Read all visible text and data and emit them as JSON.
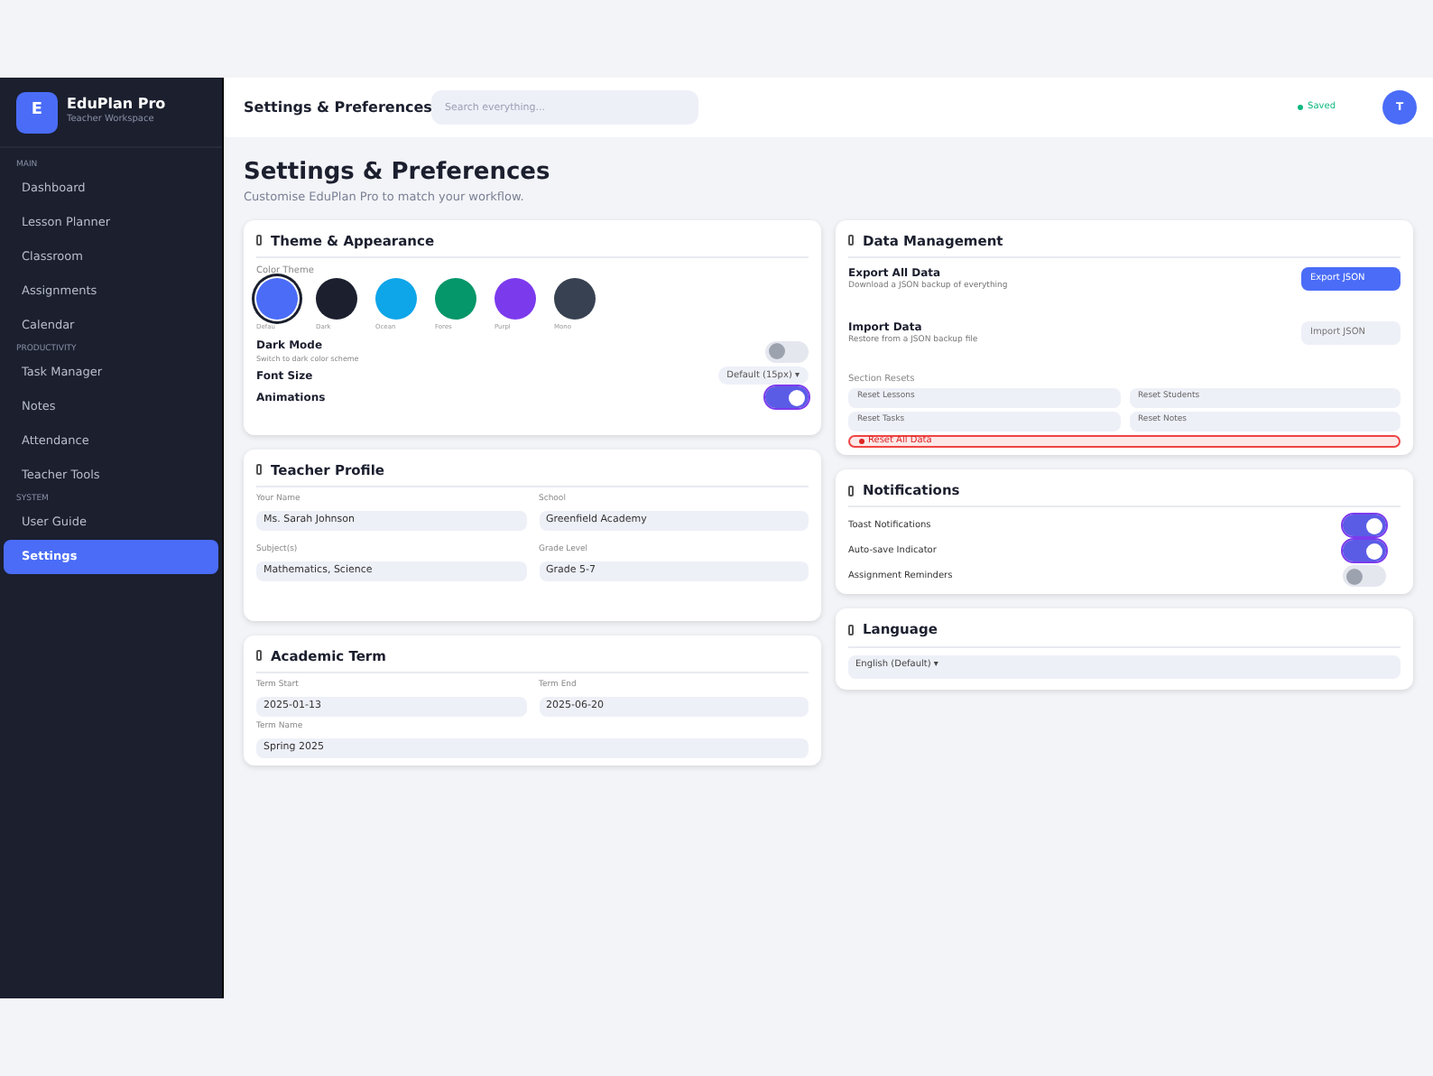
{
  "sidebar": {
    "logo_letter": "E",
    "app_name": "EduPlan Pro",
    "subtitle": "Teacher Workspace",
    "sections": [
      {
        "label": "MAIN",
        "items": [
          {
            "label": "Dashboard",
            "selected": false
          },
          {
            "label": "Lesson Planner",
            "selected": false
          },
          {
            "label": "Classroom",
            "selected": false
          },
          {
            "label": "Assignments",
            "selected": false
          },
          {
            "label": "Calendar",
            "selected": false
          }
        ]
      },
      {
        "label": "PRODUCTIVITY",
        "items": [
          {
            "label": "Task Manager",
            "selected": false
          },
          {
            "label": "Notes",
            "selected": false
          },
          {
            "label": "Attendance",
            "selected": false
          },
          {
            "label": "Teacher Tools",
            "selected": false
          }
        ]
      },
      {
        "label": "SYSTEM",
        "items": [
          {
            "label": "User Guide",
            "selected": false
          },
          {
            "label": "Settings",
            "selected": true
          }
        ]
      }
    ]
  },
  "header": {
    "title": "Settings & Preferences",
    "search": {
      "placeholder": "Search everything..."
    },
    "status": "Saved",
    "avatar": "T"
  },
  "page": {
    "title": "Settings & Preferences",
    "subtitle": "Customise EduPlan Pro to match your workflow."
  },
  "theme_card": {
    "title": "Theme & Appearance",
    "color_theme_label": "Color Theme",
    "themes": [
      {
        "label": "Defau",
        "color": "#4a6cf7",
        "selected": true
      },
      {
        "label": "Dark",
        "color": "#1b1f2e",
        "selected": false
      },
      {
        "label": "Ocean",
        "color": "#0ea5e9",
        "selected": false
      },
      {
        "label": "Fores",
        "color": "#059669",
        "selected": false
      },
      {
        "label": "Purpl",
        "color": "#7c3aed",
        "selected": false
      },
      {
        "label": "Mono",
        "color": "#374151",
        "selected": false
      }
    ],
    "dark_mode": {
      "label": "Dark Mode",
      "hint": "Switch to dark color scheme",
      "on": false
    },
    "font_size": {
      "label": "Font Size",
      "value": "Default (15px) ▾"
    },
    "animations": {
      "label": "Animations",
      "on": true
    }
  },
  "profile_card": {
    "title": "Teacher Profile",
    "fields": [
      {
        "label": "Your Name",
        "value": "Ms. Sarah Johnson"
      },
      {
        "label": "School",
        "value": "Greenfield Academy"
      },
      {
        "label": "Subject(s)",
        "value": "Mathematics, Science"
      },
      {
        "label": "Grade Level",
        "value": "Grade 5-7"
      }
    ]
  },
  "term_card": {
    "title": "Academic Term",
    "fields": [
      {
        "label": "Term Start",
        "value": "2025-01-13"
      },
      {
        "label": "Term End",
        "value": "2025-06-20"
      }
    ],
    "name_field": {
      "label": "Term Name",
      "value": "Spring 2025"
    }
  },
  "data_card": {
    "title": "Data Management",
    "rows": [
      {
        "title": "Export All Data",
        "hint": "Download a JSON backup of everything",
        "button": "Export JSON",
        "kind": "primary"
      },
      {
        "title": "Import Data",
        "hint": "Restore from a JSON backup file",
        "button": "Import JSON",
        "kind": "secondary"
      }
    ],
    "resets_label": "Section Resets",
    "resets": [
      "Reset Lessons",
      "Reset Students",
      "Reset Tasks",
      "Reset Notes"
    ],
    "reset_all": "Reset All Data"
  },
  "notifications_card": {
    "title": "Notifications",
    "toggles": [
      {
        "label": "Toast Notifications",
        "on": true
      },
      {
        "label": "Auto-save Indicator",
        "on": true
      },
      {
        "label": "Assignment Reminders",
        "on": false
      }
    ]
  },
  "language_card": {
    "title": "Language",
    "value": "English (Default) ▾"
  }
}
